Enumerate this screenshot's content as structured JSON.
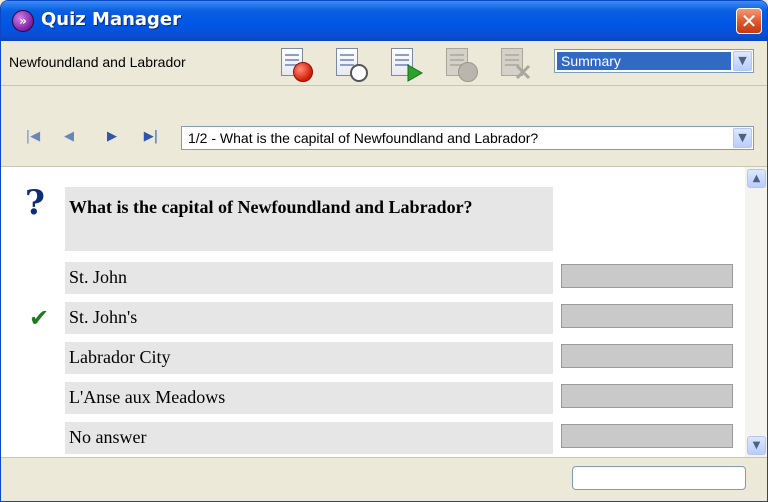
{
  "window": {
    "title": "Quiz Manager",
    "close_label": "✕"
  },
  "toolbar": {
    "quiz_name": "Newfoundland and Labrador",
    "view_selected": "Summary",
    "icons": [
      "stop-quiz-icon",
      "timer-icon",
      "start-quiz-icon",
      "cancel-quiz-icon",
      "delete-quiz-icon"
    ]
  },
  "navigation": {
    "first": "|◀",
    "prev": "◀",
    "next": "▶",
    "last": "▶|",
    "question_selected": "1/2 - What is the capital of Newfoundland and Labrador?"
  },
  "question": {
    "text": "What is the capital of Newfoundland and Labrador?",
    "answers": [
      {
        "text": "St. John",
        "correct": false,
        "response_share": 0
      },
      {
        "text": "St. John's",
        "correct": true,
        "response_share": 0
      },
      {
        "text": "Labrador City",
        "correct": false,
        "response_share": 0
      },
      {
        "text": "L'Anse aux Meadows",
        "correct": false,
        "response_share": 0
      },
      {
        "text": "No answer",
        "correct": false,
        "response_share": 0
      }
    ]
  },
  "colors": {
    "titlebar": "#0a5ee0",
    "correct_check": "#1f7a1f",
    "answer_row": "#e6e6e6",
    "bar": "#c9c9c9"
  }
}
